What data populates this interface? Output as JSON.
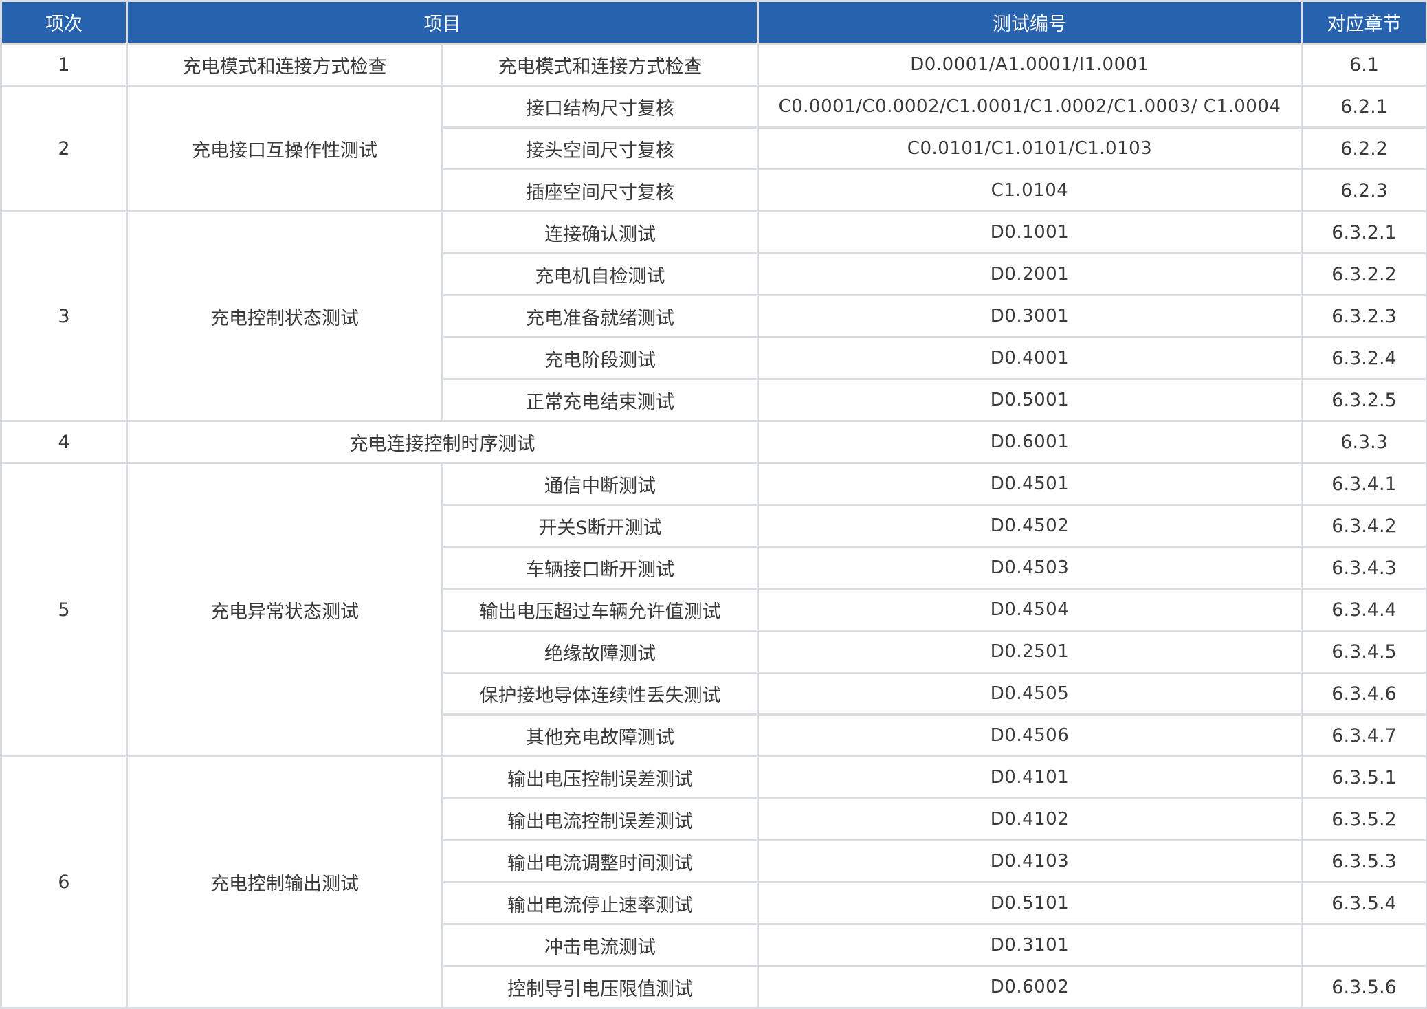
{
  "header": {
    "index": "项次",
    "item": "项目",
    "test_id": "测试编号",
    "section": "对应章节"
  },
  "groups": [
    {
      "no": "1",
      "name": "充电模式和连接方式检查",
      "rows": [
        {
          "sub": "充电模式和连接方式检查",
          "code": "D0.0001/A1.0001/I1.0001",
          "section": "6.1"
        }
      ]
    },
    {
      "no": "2",
      "name": "充电接口互操作性测试",
      "rows": [
        {
          "sub": "接口结构尺寸复核",
          "code": "C0.0001/C0.0002/C1.0001/C1.0002/C1.0003/ C1.0004",
          "section": "6.2.1"
        },
        {
          "sub": "接头空间尺寸复核",
          "code": "C0.0101/C1.0101/C1.0103",
          "section": "6.2.2"
        },
        {
          "sub": "插座空间尺寸复核",
          "code": "C1.0104",
          "section": "6.2.3"
        }
      ]
    },
    {
      "no": "3",
      "name": "充电控制状态测试",
      "rows": [
        {
          "sub": "连接确认测试",
          "code": "D0.1001",
          "section": "6.3.2.1"
        },
        {
          "sub": "充电机自检测试",
          "code": "D0.2001",
          "section": "6.3.2.2"
        },
        {
          "sub": "充电准备就绪测试",
          "code": "D0.3001",
          "section": "6.3.2.3"
        },
        {
          "sub": "充电阶段测试",
          "code": "D0.4001",
          "section": "6.3.2.4"
        },
        {
          "sub": "正常充电结束测试",
          "code": "D0.5001",
          "section": "6.3.2.5"
        }
      ]
    },
    {
      "no": "4",
      "name": "充电连接控制时序测试",
      "merged": true,
      "rows": [
        {
          "sub": "",
          "code": "D0.6001",
          "section": "6.3.3"
        }
      ]
    },
    {
      "no": "5",
      "name": "充电异常状态测试",
      "rows": [
        {
          "sub": "通信中断测试",
          "code": "D0.4501",
          "section": "6.3.4.1"
        },
        {
          "sub": "开关S断开测试",
          "code": "D0.4502",
          "section": "6.3.4.2"
        },
        {
          "sub": "车辆接口断开测试",
          "code": "D0.4503",
          "section": "6.3.4.3"
        },
        {
          "sub": "输出电压超过车辆允许值测试",
          "code": "D0.4504",
          "section": "6.3.4.4"
        },
        {
          "sub": "绝缘故障测试",
          "code": "D0.2501",
          "section": "6.3.4.5"
        },
        {
          "sub": "保护接地导体连续性丢失测试",
          "code": "D0.4505",
          "section": "6.3.4.6"
        },
        {
          "sub": "其他充电故障测试",
          "code": "D0.4506",
          "section": "6.3.4.7"
        }
      ]
    },
    {
      "no": "6",
      "name": "充电控制输出测试",
      "rows": [
        {
          "sub": "输出电压控制误差测试",
          "code": "D0.4101",
          "section": "6.3.5.1"
        },
        {
          "sub": "输出电流控制误差测试",
          "code": "D0.4102",
          "section": "6.3.5.2"
        },
        {
          "sub": "输出电流调整时间测试",
          "code": "D0.4103",
          "section": "6.3.5.3"
        },
        {
          "sub": "输出电流停止速率测试",
          "code": "D0.5101",
          "section": "6.3.5.4"
        },
        {
          "sub": "冲击电流测试",
          "code": "D0.3101",
          "section": ""
        },
        {
          "sub": "控制导引电压限值测试",
          "code": "D0.6002",
          "section": "6.3.5.6"
        }
      ]
    }
  ]
}
